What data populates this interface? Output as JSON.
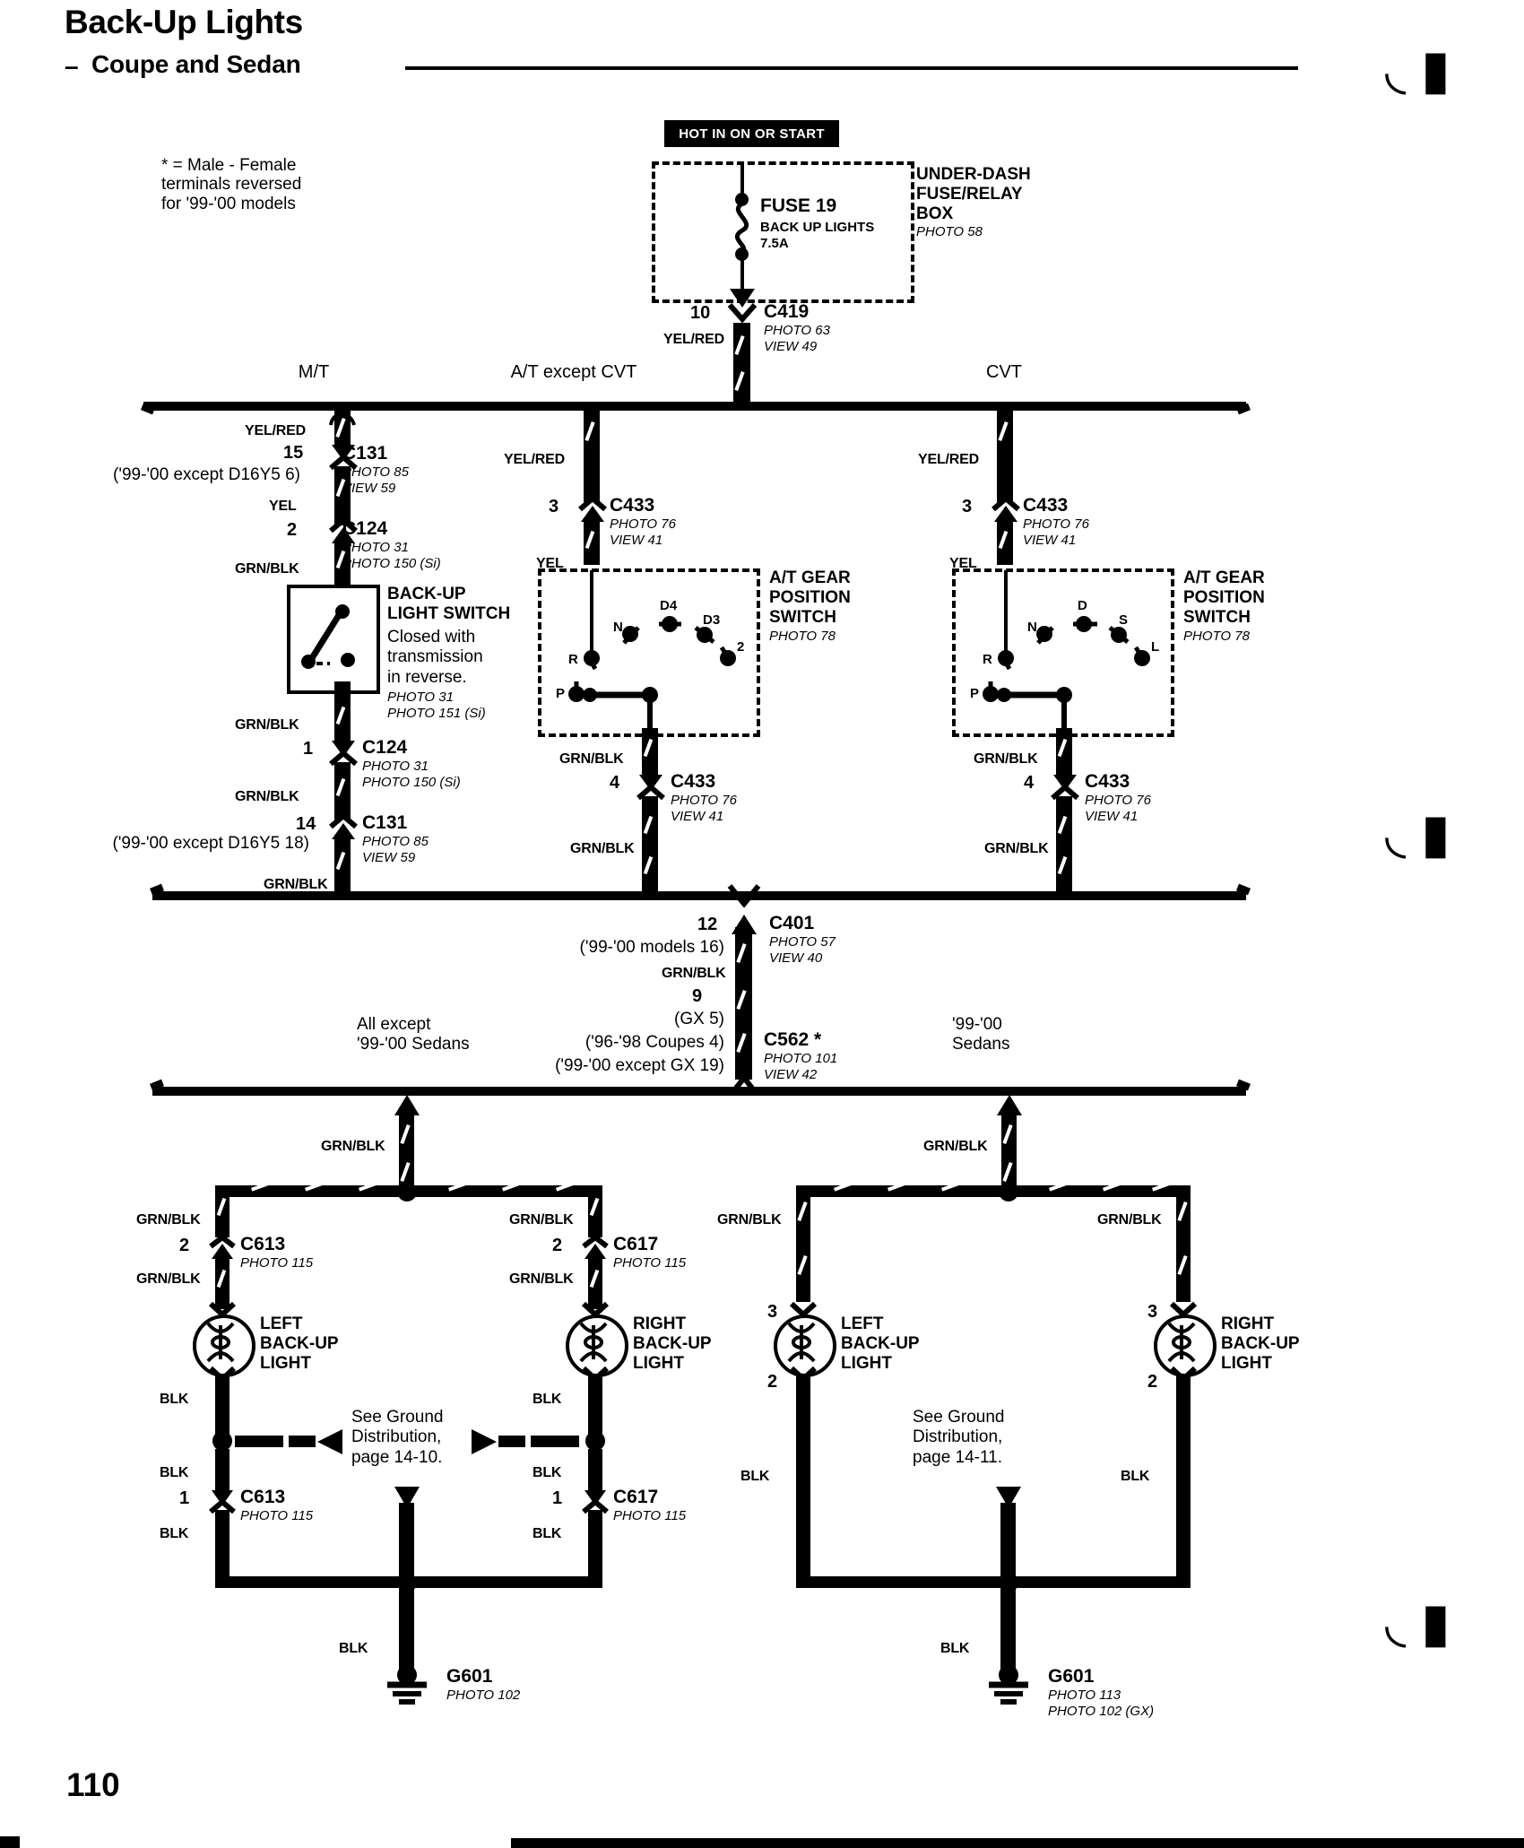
{
  "page": {
    "title": "Back-Up Lights",
    "subtitle": "Coupe and Sedan",
    "number": "110",
    "footnote": "* = Male - Female\nterminals reversed\nfor '99-'00 models"
  },
  "power": {
    "hot_label": "HOT IN ON OR START",
    "box_label": "UNDER-DASH\nFUSE/RELAY\nBOX",
    "box_photo": "PHOTO 58",
    "fuse_name": "FUSE 19",
    "fuse_desc": "BACK UP LIGHTS",
    "fuse_rating": "7.5A",
    "out_pin": "10",
    "out_wire": "YEL/RED",
    "out_connector": "C419",
    "out_photo": "PHOTO 63",
    "out_view": "VIEW 49"
  },
  "columns": {
    "mt": "M/T",
    "at": "A/T except CVT",
    "cvt": "CVT"
  },
  "mt_branch": {
    "wire_top": "YEL/RED",
    "c131_top_pin": "15",
    "c131_top_name": "C131",
    "c131_top_photo": "PHOTO 85",
    "c131_top_view": "VIEW 59",
    "c131_top_alt": "('99-'00 except D16Y5 6)",
    "wire_mid": "YEL",
    "c124_top_pin": "2",
    "c124_top_name": "C124",
    "c124_top_photo1": "PHOTO 31",
    "c124_top_photo2": "PHOTO 150 (Si)",
    "wire_to_switch": "GRN/BLK",
    "switch_title": "BACK-UP\nLIGHT SWITCH",
    "switch_desc": "Closed with\ntransmission\nin reverse.",
    "switch_photo1": "PHOTO 31",
    "switch_photo2": "PHOTO 151 (Si)",
    "wire_below_switch": "GRN/BLK",
    "c124_bot_pin": "1",
    "c124_bot_name": "C124",
    "c124_bot_photo1": "PHOTO 31",
    "c124_bot_photo2": "PHOTO 150 (Si)",
    "wire_below_c124": "GRN/BLK",
    "c131_bot_pin": "14",
    "c131_bot_name": "C131",
    "c131_bot_photo": "PHOTO 85",
    "c131_bot_view": "VIEW 59",
    "c131_bot_alt": "('99-'00 except D16Y5 18)",
    "wire_bottom": "GRN/BLK"
  },
  "at_branch": {
    "wire_top": "YEL/RED",
    "c433_top_pin": "3",
    "c433_top_name": "C433",
    "c433_top_photo": "PHOTO 76",
    "c433_top_view": "VIEW 41",
    "wire_mid": "YEL",
    "switch_title": "A/T GEAR\nPOSITION\nSWITCH",
    "switch_photo": "PHOTO 78",
    "positions": [
      "R",
      "N",
      "D4",
      "D3",
      "2",
      "P"
    ],
    "wire_out": "GRN/BLK",
    "c433_bot_pin": "4",
    "c433_bot_name": "C433",
    "c433_bot_photo": "PHOTO 76",
    "c433_bot_view": "VIEW 41",
    "wire_bottom": "GRN/BLK"
  },
  "cvt_branch": {
    "wire_top": "YEL/RED",
    "c433_top_pin": "3",
    "c433_top_name": "C433",
    "c433_top_photo": "PHOTO 76",
    "c433_top_view": "VIEW 41",
    "wire_mid": "YEL",
    "switch_title": "A/T GEAR\nPOSITION\nSWITCH",
    "switch_photo": "PHOTO 78",
    "positions": [
      "R",
      "N",
      "D",
      "S",
      "L",
      "P"
    ],
    "wire_out": "GRN/BLK",
    "c433_bot_pin": "4",
    "c433_bot_name": "C433",
    "c433_bot_photo": "PHOTO 76",
    "c433_bot_view": "VIEW 41",
    "wire_bottom": "GRN/BLK"
  },
  "mid": {
    "c401_pin": "12",
    "c401_alt": "('99-'00 models 16)",
    "c401_name": "C401",
    "c401_photo": "PHOTO 57",
    "c401_view": "VIEW 40",
    "wire": "GRN/BLK",
    "c562_pin": "9",
    "c562_alt1": "(GX 5)",
    "c562_alt2": "('96-'98 Coupes 4)",
    "c562_alt3": "('99-'00 except GX 19)",
    "c562_name": "C562 *",
    "c562_photo": "PHOTO 101",
    "c562_view": "VIEW 42",
    "left_group": "All except\n'99-'00 Sedans",
    "right_group": "'99-'00\nSedans"
  },
  "lamps_left_group": {
    "feed_wire": "GRN/BLK",
    "left": {
      "wire_above": "GRN/BLK",
      "conn_pin_top": "2",
      "conn_name_top": "C613",
      "conn_photo_top": "PHOTO 115",
      "wire_below_conn": "GRN/BLK",
      "lamp_label": "LEFT\nBACK-UP\nLIGHT",
      "wire_gnd_top": "BLK",
      "wire_gnd_mid": "BLK",
      "conn_pin_bot": "1",
      "conn_name_bot": "C613",
      "conn_photo_bot": "PHOTO 115",
      "wire_gnd_bot": "BLK"
    },
    "right": {
      "wire_above": "GRN/BLK",
      "conn_pin_top": "2",
      "conn_name_top": "C617",
      "conn_photo_top": "PHOTO 115",
      "wire_below_conn": "GRN/BLK",
      "lamp_label": "RIGHT\nBACK-UP\nLIGHT",
      "wire_gnd_top": "BLK",
      "wire_gnd_mid": "BLK",
      "conn_pin_bot": "1",
      "conn_name_bot": "C617",
      "conn_photo_bot": "PHOTO 115",
      "wire_gnd_bot": "BLK"
    },
    "ground_note": "See Ground\nDistribution,\npage 14-10.",
    "ground_wire": "BLK",
    "ground_name": "G601",
    "ground_photo": "PHOTO 102"
  },
  "lamps_right_group": {
    "feed_wire": "GRN/BLK",
    "left": {
      "wire_above": "GRN/BLK",
      "conn_pin_top": "3",
      "lamp_label": "LEFT\nBACK-UP\nLIGHT",
      "conn_pin_bot": "2",
      "wire_gnd": "BLK"
    },
    "right": {
      "wire_above": "GRN/BLK",
      "conn_pin_top": "3",
      "lamp_label": "RIGHT\nBACK-UP\nLIGHT",
      "conn_pin_bot": "2",
      "wire_gnd": "BLK"
    },
    "ground_note": "See Ground\nDistribution,\npage 14-11.",
    "ground_wire": "BLK",
    "ground_name": "G601",
    "ground_photo1": "PHOTO 113",
    "ground_photo2": "PHOTO 102 (GX)"
  }
}
